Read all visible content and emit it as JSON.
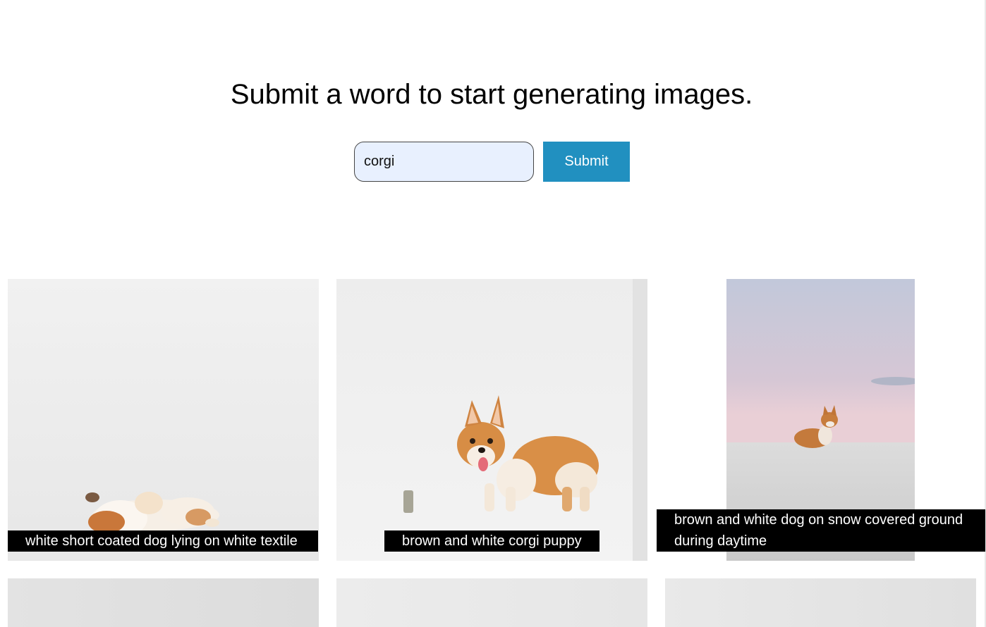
{
  "header": {
    "title": "Submit a word to start generating images."
  },
  "search": {
    "value": "corgi",
    "submit_label": "Submit"
  },
  "results": [
    {
      "caption": "white short coated dog lying on white textile"
    },
    {
      "caption": "brown and white corgi puppy"
    },
    {
      "caption": "brown and white dog on snow covered ground during daytime"
    }
  ],
  "colors": {
    "accent": "#2190c0",
    "input_bg": "#e8f0fe",
    "caption_bg": "#000000"
  }
}
